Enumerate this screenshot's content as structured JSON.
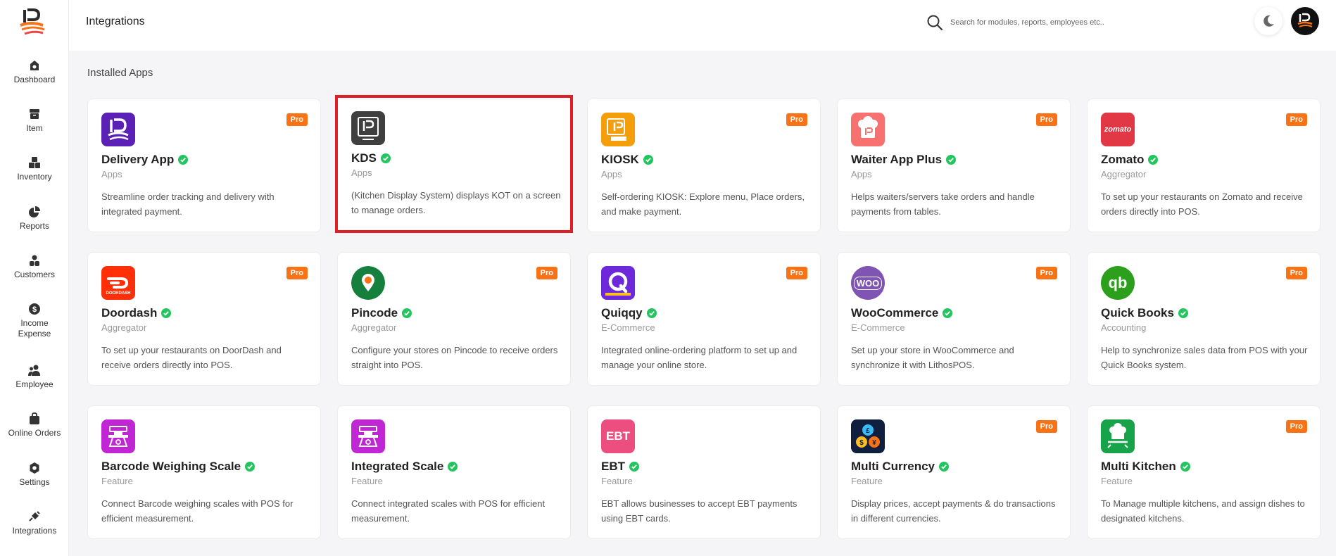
{
  "header": {
    "title": "Integrations",
    "search_placeholder": "Search for modules, reports, employees etc.."
  },
  "sidebar": {
    "items": [
      {
        "label": "Dashboard"
      },
      {
        "label": "Item"
      },
      {
        "label": "Inventory"
      },
      {
        "label": "Reports"
      },
      {
        "label": "Customers"
      },
      {
        "label": "Income Expense"
      },
      {
        "label": "Employee"
      },
      {
        "label": "Online Orders"
      },
      {
        "label": "Settings"
      },
      {
        "label": "Integrations"
      }
    ]
  },
  "main": {
    "section_title": "Installed Apps",
    "pro_label": "Pro",
    "cards": [
      {
        "name": "Delivery App",
        "category": "Apps",
        "description": "Streamline order tracking and delivery with integrated payment.",
        "pro": true,
        "icon": "delivery-app-icon",
        "color": "#5b21b6"
      },
      {
        "name": "KDS",
        "category": "Apps",
        "description": "(Kitchen Display System) displays KOT on a screen to manage orders.",
        "pro": false,
        "icon": "kds-icon",
        "color": "#3f3f3f"
      },
      {
        "name": "KIOSK",
        "category": "Apps",
        "description": "Self-ordering KIOSK: Explore menu, Place orders, and make payment.",
        "pro": true,
        "icon": "kiosk-icon",
        "color": "#f59e0b"
      },
      {
        "name": "Waiter App Plus",
        "category": "Apps",
        "description": "Helps waiters/servers take orders and handle payments from tables.",
        "pro": true,
        "icon": "waiter-app-icon",
        "color": "#f87171"
      },
      {
        "name": "Zomato",
        "category": "Aggregator",
        "description": "To set up your restaurants on Zomato and receive orders directly into POS.",
        "pro": true,
        "icon": "zomato-icon",
        "color": "#e23744",
        "logo_text": "zomato"
      },
      {
        "name": "Doordash",
        "category": "Aggregator",
        "description": "To set up your restaurants on DoorDash and receive orders directly into POS.",
        "pro": true,
        "icon": "doordash-icon",
        "color": "#ff3008",
        "logo_text": "DOORDASH"
      },
      {
        "name": "Pincode",
        "category": "Aggregator",
        "description": "Configure your stores on Pincode to receive orders straight into POS.",
        "pro": true,
        "icon": "pincode-icon",
        "color": "#15803d"
      },
      {
        "name": "Quiqqy",
        "category": "E-Commerce",
        "description": "Integrated online-ordering platform to set up and manage your online store.",
        "pro": true,
        "icon": "quiqqy-icon",
        "color": "#6d28d9"
      },
      {
        "name": "WooCommerce",
        "category": "E-Commerce",
        "description": "Set up your store in WooCommerce and synchronize it with LithosPOS.",
        "pro": true,
        "icon": "woocommerce-icon",
        "color": "#7f54b3",
        "logo_text": "WOO"
      },
      {
        "name": "Quick Books",
        "category": "Accounting",
        "description": "Help to synchronize sales data from POS with your Quick Books system.",
        "pro": true,
        "icon": "quickbooks-icon",
        "color": "#2ca01c",
        "logo_text": "qb"
      },
      {
        "name": "Barcode Weighing Scale",
        "category": "Feature",
        "description": "Connect Barcode weighing scales with POS for efficient measurement.",
        "pro": false,
        "icon": "barcode-scale-icon",
        "color": "#c026d3"
      },
      {
        "name": "Integrated Scale",
        "category": "Feature",
        "description": "Connect integrated scales with POS for efficient measurement.",
        "pro": false,
        "icon": "integrated-scale-icon",
        "color": "#c026d3"
      },
      {
        "name": "EBT",
        "category": "Feature",
        "description": "EBT allows businesses to accept EBT payments using EBT cards.",
        "pro": false,
        "icon": "ebt-icon",
        "color": "#ec4f7f",
        "logo_text": "EBT"
      },
      {
        "name": "Multi Currency",
        "category": "Feature",
        "description": "Display prices, accept payments & do transactions in different currencies.",
        "pro": true,
        "icon": "multi-currency-icon",
        "color": "#0f1f3d"
      },
      {
        "name": "Multi Kitchen",
        "category": "Feature",
        "description": "To Manage multiple kitchens, and assign dishes to designated kitchens.",
        "pro": true,
        "icon": "multi-kitchen-icon",
        "color": "#16a34a"
      }
    ]
  },
  "colors": {
    "accent": "#f97316",
    "verified": "#22c55e",
    "selection": "#e11d26"
  }
}
